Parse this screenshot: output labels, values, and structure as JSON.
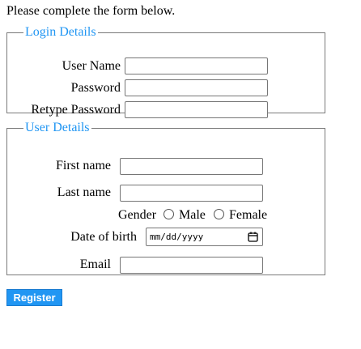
{
  "intro": "Please complete the form below.",
  "login_details": {
    "legend": "Login Details",
    "user_name_label": "User Name",
    "password_label": "Password",
    "retype_password_label": "Retype Password"
  },
  "user_details": {
    "legend": "User Details",
    "first_name_label": "First name",
    "last_name_label": "Last name",
    "gender_label": "Gender",
    "male_label": "Male",
    "female_label": "Female",
    "dob_label": "Date of birth",
    "dob_placeholder": "mm/dd/yyyy",
    "email_label": "Email"
  },
  "register_label": "Register",
  "colors": {
    "legend": "#2196f3",
    "button": "#2196f3"
  },
  "icons": {
    "date_picker": "calendar-icon"
  }
}
